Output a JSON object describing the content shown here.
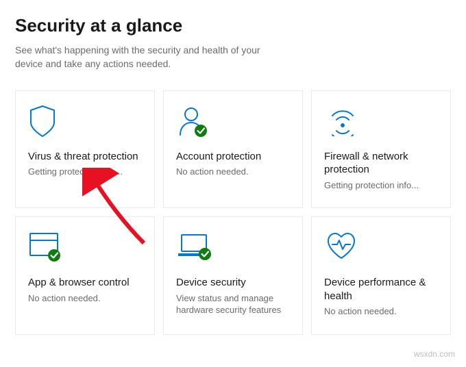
{
  "header": {
    "title": "Security at a glance",
    "subtitle": "See what's happening with the security and health of your device and take any actions needed."
  },
  "tiles": [
    {
      "title": "Virus & threat protection",
      "status": "Getting protection info...",
      "icon": "shield"
    },
    {
      "title": "Account protection",
      "status": "No action needed.",
      "icon": "account-check"
    },
    {
      "title": "Firewall & network protection",
      "status": "Getting protection info...",
      "icon": "wifi"
    },
    {
      "title": "App & browser control",
      "status": "No action needed.",
      "icon": "browser-check"
    },
    {
      "title": "Device security",
      "status": "View status and manage hardware security features",
      "icon": "laptop-check"
    },
    {
      "title": "Device performance & health",
      "status": "No action needed.",
      "icon": "heart"
    }
  ],
  "colors": {
    "accent": "#0078d4",
    "ok": "#107c10",
    "arrow": "#e81123"
  },
  "watermark": "wsxdn.com"
}
